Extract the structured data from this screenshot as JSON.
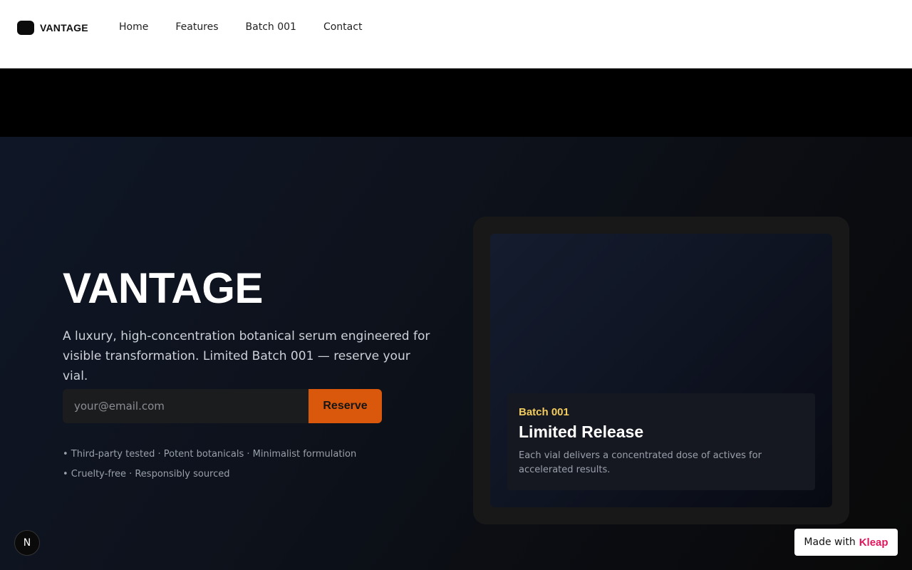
{
  "nav": {
    "brand": "VANTAGE",
    "links": [
      "Home",
      "Features",
      "Batch 001",
      "Contact"
    ]
  },
  "hero": {
    "title": "VANTAGE",
    "subtitle": "A luxury, high-concentration botanical serum engineered for visible transformation. Limited Batch 001 — reserve your vial.",
    "email_placeholder": "your@email.com",
    "reserve_label": "Reserve",
    "bullets": [
      "• Third-party tested · Potent botanicals · Minimalist formulation",
      "• Cruelty-free · Responsibly sourced"
    ]
  },
  "card": {
    "tag": "Batch 001",
    "title": "Limited Release",
    "description": "Each vial delivers a concentrated dose of actives for accelerated results."
  },
  "footer": {
    "badge": "N",
    "made_with": "Made with",
    "made_brand": "Kleap"
  },
  "colors": {
    "accent": "#d9580b",
    "tag": "#f2cc5c",
    "kleap": "#e0155c"
  }
}
